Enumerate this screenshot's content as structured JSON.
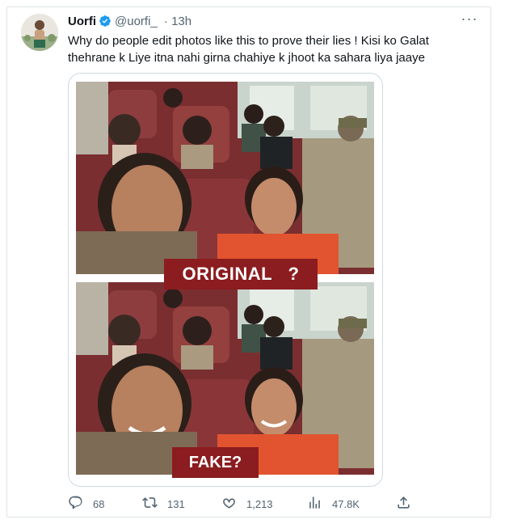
{
  "tweet": {
    "display_name": "Uorfi",
    "handle": "@uorfi_",
    "separator": "·",
    "time": "13h",
    "more_label": "···",
    "text": "Why do people edit photos like this to prove their lies !  Kisi ko Galat thehrane k Liye itna nahi girna chahiye k jhoot ka sahara liya jaaye"
  },
  "media": {
    "label_original": "ORIGINAL   ?",
    "label_fake": "FAKE?"
  },
  "actions": {
    "replies": "68",
    "retweets": "131",
    "likes": "1,213",
    "views": "47.8K"
  },
  "colors": {
    "accent": "#1d9bf0",
    "label_bg": "#8b1c1f",
    "muted": "#536471"
  },
  "icons": [
    "verified-icon",
    "more-icon",
    "reply-icon",
    "retweet-icon",
    "like-icon",
    "views-icon",
    "share-icon"
  ]
}
